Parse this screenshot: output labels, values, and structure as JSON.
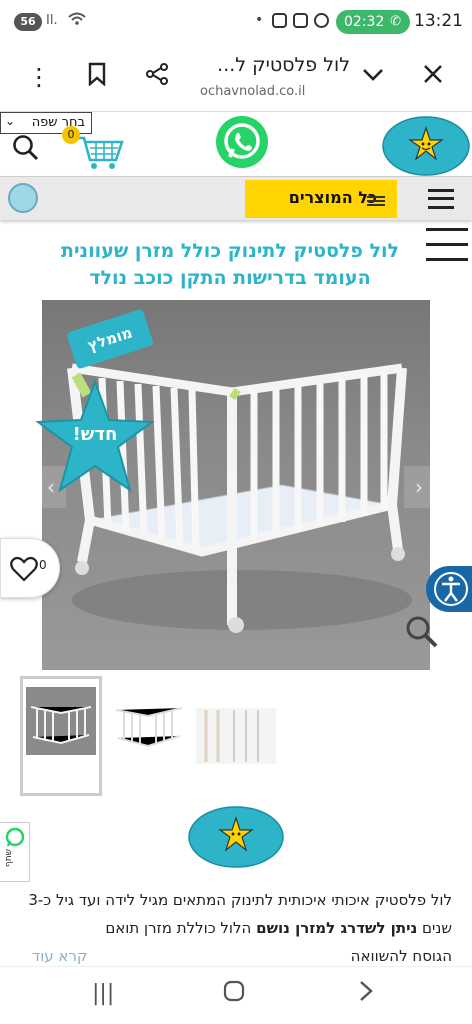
{
  "status_bar": {
    "badge": "56",
    "signal": "Il.",
    "call_time": "02:32",
    "clock": "13:21"
  },
  "browser": {
    "page_title": "לול פלסטיק ל...",
    "url": "ochavnolad.co.il",
    "icons": [
      "more-vert-icon",
      "bookmark-icon",
      "share-icon",
      "chevron-down-icon",
      "close-icon"
    ]
  },
  "header": {
    "language_select": "בחר שפה",
    "cart_count": "0"
  },
  "nav": {
    "all_products": "כל המוצרים"
  },
  "product": {
    "title": "לול פלסטיק לתינוק כולל מזרן שעוונית העומד בדרישות התקן כוכב נולד",
    "tag_recommended": "מומלץ",
    "star_new": "חדש!",
    "like_count": "0",
    "description_part1": "לול פלסטיק איכותי איכותית לתינוק המתאים מגיל לידה ועד גיל כ-3 שנים ",
    "description_bold": "ניתן לשדרג למזרן נושם",
    "description_part2": " הלול כוללת מזרן תואם",
    "description_line3": "הגוסח להשוואה",
    "read_more": "קרא עוד"
  },
  "share": {
    "label": "שתף"
  },
  "colors": {
    "accent": "#2eb4c9",
    "yellow": "#ffd400",
    "whatsapp": "#25d366",
    "accessibility": "#1868a8"
  }
}
